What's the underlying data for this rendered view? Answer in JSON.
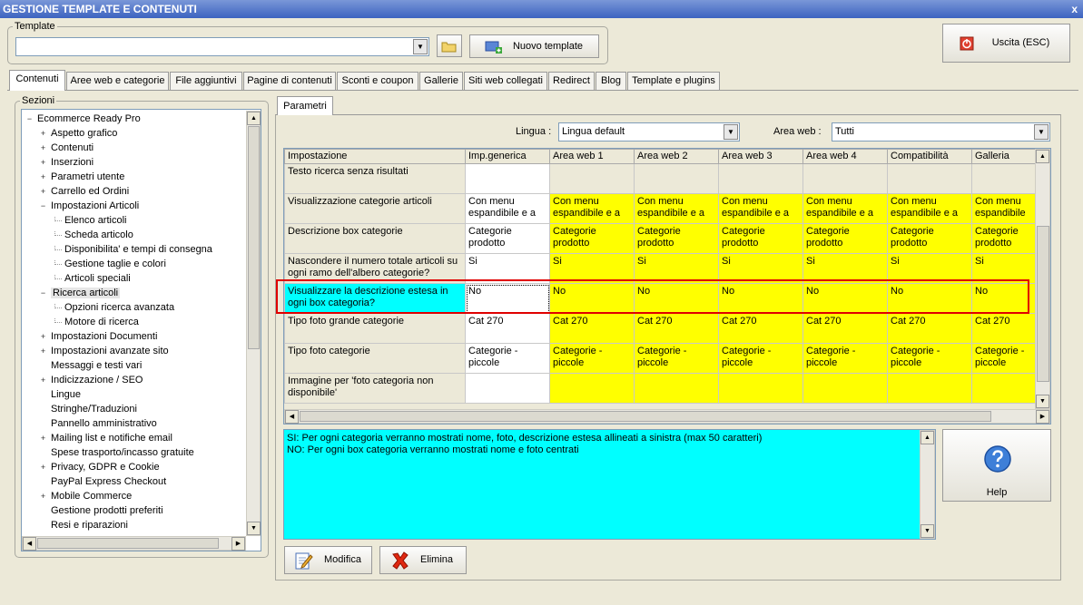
{
  "window": {
    "title": "GESTIONE TEMPLATE E CONTENUTI",
    "close_glyph": "x"
  },
  "template": {
    "group_label": "Template",
    "value": "",
    "new_label": "Nuovo template"
  },
  "exit_label": "Uscita (ESC)",
  "tabs": [
    {
      "label": "Contenuti"
    },
    {
      "label": "Aree web e categorie"
    },
    {
      "label": "File aggiuntivi"
    },
    {
      "label": "Pagine di contenuti"
    },
    {
      "label": "Sconti e coupon"
    },
    {
      "label": "Gallerie"
    },
    {
      "label": "Siti web collegati"
    },
    {
      "label": "Redirect"
    },
    {
      "label": "Blog"
    },
    {
      "label": "Template e plugins"
    }
  ],
  "sections": {
    "label": "Sezioni",
    "items": [
      {
        "label": "Ecommerce Ready Pro",
        "exp": "−"
      },
      {
        "label": "Aspetto grafico",
        "exp": "+"
      },
      {
        "label": "Contenuti",
        "exp": "+"
      },
      {
        "label": "Inserzioni",
        "exp": "+"
      },
      {
        "label": "Parametri utente",
        "exp": "+"
      },
      {
        "label": "Carrello ed Ordini",
        "exp": "+"
      },
      {
        "label": "Impostazioni Articoli",
        "exp": "−"
      },
      {
        "label": "Elenco articoli",
        "exp": ""
      },
      {
        "label": "Scheda articolo",
        "exp": ""
      },
      {
        "label": "Disponibilita' e tempi di consegna",
        "exp": ""
      },
      {
        "label": "Gestione taglie e colori",
        "exp": ""
      },
      {
        "label": "Articoli speciali",
        "exp": ""
      },
      {
        "label": "Ricerca articoli",
        "exp": "−"
      },
      {
        "label": "Opzioni ricerca avanzata",
        "exp": ""
      },
      {
        "label": "Motore di ricerca",
        "exp": ""
      },
      {
        "label": "Impostazioni Documenti",
        "exp": "+"
      },
      {
        "label": "Impostazioni avanzate sito",
        "exp": "+"
      },
      {
        "label": "Messaggi e testi vari",
        "exp": ""
      },
      {
        "label": "Indicizzazione / SEO",
        "exp": "+"
      },
      {
        "label": "Lingue",
        "exp": ""
      },
      {
        "label": "Stringhe/Traduzioni",
        "exp": ""
      },
      {
        "label": "Pannello amministrativo",
        "exp": ""
      },
      {
        "label": "Mailing list e notifiche email",
        "exp": "+"
      },
      {
        "label": "Spese trasporto/incasso gratuite",
        "exp": ""
      },
      {
        "label": "Privacy, GDPR e Cookie",
        "exp": "+"
      },
      {
        "label": "PayPal Express Checkout",
        "exp": ""
      },
      {
        "label": "Mobile Commerce",
        "exp": "+"
      },
      {
        "label": "Gestione prodotti preferiti",
        "exp": ""
      },
      {
        "label": "Resi e riparazioni",
        "exp": ""
      }
    ]
  },
  "params": {
    "tab_label": "Parametri",
    "lingua_label": "Lingua :",
    "lingua_value": "Lingua default",
    "area_label": "Area web :",
    "area_value": "Tutti"
  },
  "grid": {
    "columns": [
      "Impostazione",
      "Imp.generica",
      "Area web 1",
      "Area web 2",
      "Area web 3",
      "Area web 4",
      "Compatibilità",
      "Galleria"
    ],
    "rows": [
      {
        "name": "Testo ricerca senza risultati",
        "values": [
          "",
          "",
          "",
          "",
          "",
          "",
          ""
        ]
      },
      {
        "name": "Visualizzazione categorie articoli",
        "values": [
          "Con menu espandibile e a …",
          "Con menu espandibile e a …",
          "Con menu espandibile e a …",
          "Con menu espandibile e a …",
          "Con menu espandibile e a …",
          "Con menu espandibile e a …",
          "Con menu espandibile e"
        ]
      },
      {
        "name": "Descrizione box categorie",
        "values": [
          "Categorie prodotto",
          "Categorie prodotto",
          "Categorie prodotto",
          "Categorie prodotto",
          "Categorie prodotto",
          "Categorie prodotto",
          "Categorie prodotto"
        ]
      },
      {
        "name": "Nascondere il numero totale articoli su ogni ramo dell'albero categorie?",
        "values": [
          "Si",
          "Si",
          "Si",
          "Si",
          "Si",
          "Si",
          "Si"
        ]
      },
      {
        "name": "Visualizzare la descrizione estesa in ogni box categoria?",
        "values": [
          "No",
          "No",
          "No",
          "No",
          "No",
          "No",
          "No"
        ]
      },
      {
        "name": "Tipo foto grande categorie",
        "values": [
          "Cat 270",
          "Cat 270",
          "Cat 270",
          "Cat 270",
          "Cat 270",
          "Cat 270",
          "Cat 270"
        ]
      },
      {
        "name": "Tipo foto categorie",
        "values": [
          "Categorie - piccole",
          "Categorie - piccole",
          "Categorie - piccole",
          "Categorie - piccole",
          "Categorie - piccole",
          "Categorie - piccole",
          "Categorie - piccole"
        ]
      },
      {
        "name": "Immagine per 'foto categoria non disponibile'",
        "values": [
          "",
          "",
          "",
          "",
          "",
          "",
          ""
        ]
      }
    ]
  },
  "description": {
    "line1": "SI: Per ogni categoria verranno mostrati nome, foto, descrizione estesa allineati a sinistra (max 50 caratteri)",
    "line2": "NO: Per ogni box categoria verranno mostrati nome e foto centrati"
  },
  "help_label": "Help",
  "modifica_label": "Modifica",
  "elimina_label": "Elimina",
  "colors": {
    "highlight_yellow": "#FFFF00",
    "selected_cyan": "#00FFFF",
    "selection_border": "#E00000"
  }
}
